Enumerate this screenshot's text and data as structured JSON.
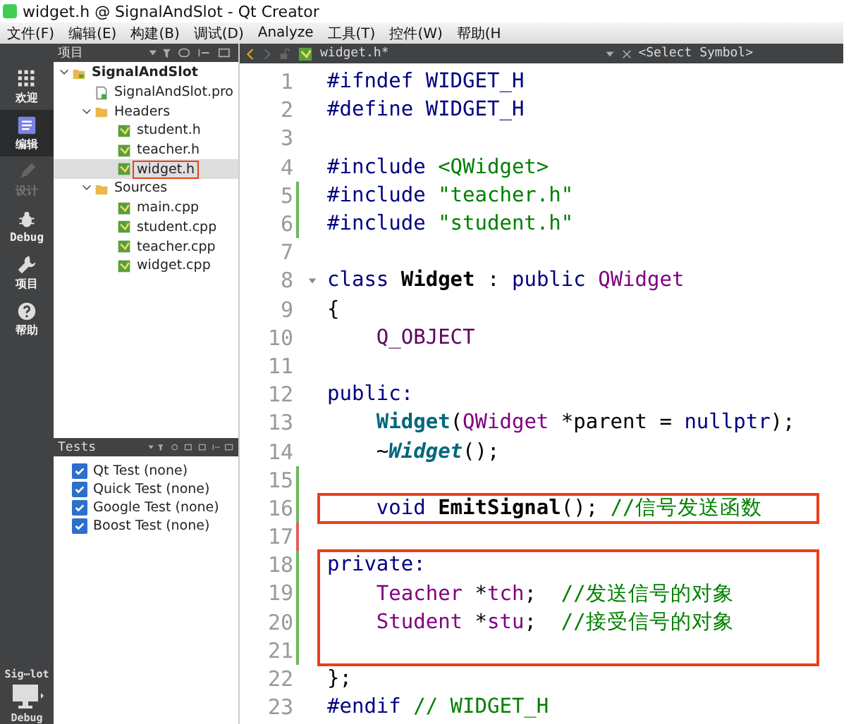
{
  "window": {
    "title": "widget.h @ SignalAndSlot - Qt Creator"
  },
  "menu": [
    "文件(F)",
    "编辑(E)",
    "构建(B)",
    "调试(D)",
    "Analyze",
    "工具(T)",
    "控件(W)",
    "帮助(H"
  ],
  "modes": [
    {
      "label": "欢迎",
      "selected": false,
      "disabled": false
    },
    {
      "label": "编辑",
      "selected": true,
      "disabled": false
    },
    {
      "label": "设计",
      "selected": false,
      "disabled": true
    },
    {
      "label": "Debug",
      "selected": false,
      "disabled": false
    },
    {
      "label": "项目",
      "selected": false,
      "disabled": false
    },
    {
      "label": "帮助",
      "selected": false,
      "disabled": false
    }
  ],
  "target": {
    "project": "Sig⋯lot",
    "label": "Debug"
  },
  "project_panel": {
    "title": "项目",
    "tree": [
      {
        "label": "SignalAndSlot",
        "kind": "project",
        "expanded": true,
        "selected": false,
        "children": [
          {
            "label": "SignalAndSlot.pro",
            "kind": "pro",
            "selected": false
          },
          {
            "label": "Headers",
            "kind": "folder",
            "expanded": true,
            "selected": false,
            "children": [
              {
                "label": "student.h",
                "kind": "file",
                "selected": false
              },
              {
                "label": "teacher.h",
                "kind": "file",
                "selected": false
              },
              {
                "label": "widget.h",
                "kind": "file",
                "selected": true
              }
            ]
          },
          {
            "label": "Sources",
            "kind": "folder",
            "expanded": true,
            "selected": false,
            "children": [
              {
                "label": "main.cpp",
                "kind": "file",
                "selected": false
              },
              {
                "label": "student.cpp",
                "kind": "file",
                "selected": false
              },
              {
                "label": "teacher.cpp",
                "kind": "file",
                "selected": false
              },
              {
                "label": "widget.cpp",
                "kind": "file",
                "selected": false
              }
            ]
          }
        ]
      }
    ]
  },
  "tests_panel": {
    "title": "Tests",
    "items": [
      {
        "label": "Qt Test (none)",
        "checked": true
      },
      {
        "label": "Quick Test (none)",
        "checked": true
      },
      {
        "label": "Google Test (none)",
        "checked": true
      },
      {
        "label": "Boost Test (none)",
        "checked": true
      }
    ]
  },
  "editor": {
    "file_tab": "widget.h*",
    "symbol": "<Select Symbol>",
    "lines": [
      {
        "number": "1",
        "tokens": [
          {
            "kind": "kw",
            "text": "#ifndef WIDGET_H"
          }
        ]
      },
      {
        "number": "2",
        "tokens": [
          {
            "kind": "kw",
            "text": "#define WIDGET_H"
          }
        ]
      },
      {
        "number": "3"
      },
      {
        "number": "4",
        "tokens": [
          {
            "kind": "kw",
            "text": "#include "
          },
          {
            "kind": "str",
            "text": "<QWidget>"
          }
        ]
      },
      {
        "number": "5",
        "changed": true,
        "saved": true,
        "tokens": [
          {
            "kind": "kw",
            "text": "#include "
          },
          {
            "kind": "str",
            "text": "\"teacher.h\""
          }
        ]
      },
      {
        "number": "6",
        "changed": true,
        "saved": true,
        "tokens": [
          {
            "kind": "kw",
            "text": "#include "
          },
          {
            "kind": "str",
            "text": "\"student.h\""
          }
        ]
      },
      {
        "number": "7"
      },
      {
        "number": "8",
        "fold": true,
        "tokens": [
          {
            "kind": "kw",
            "text": "class "
          },
          {
            "kind": "fn",
            "text": "Widget"
          },
          {
            "kind": "plain",
            "text": " : "
          },
          {
            "kind": "kw",
            "text": "public "
          },
          {
            "kind": "type",
            "text": "QWidget"
          }
        ]
      },
      {
        "number": "9",
        "tokens": [
          {
            "kind": "plain",
            "text": "{"
          }
        ]
      },
      {
        "number": "10",
        "tokens": [
          {
            "kind": "macro",
            "text": "    Q_OBJECT"
          }
        ]
      },
      {
        "number": "11"
      },
      {
        "number": "12",
        "tokens": [
          {
            "kind": "kw",
            "text": "public:"
          }
        ]
      },
      {
        "number": "13",
        "tokens": [
          {
            "kind": "fnc",
            "text": "    Widget"
          },
          {
            "kind": "plain",
            "text": "("
          },
          {
            "kind": "type",
            "text": "QWidget"
          },
          {
            "kind": "plain",
            "text": " *parent = "
          },
          {
            "kind": "kw",
            "text": "nullptr"
          },
          {
            "kind": "plain",
            "text": ");"
          }
        ]
      },
      {
        "number": "14",
        "tokens": [
          {
            "kind": "plain",
            "text": "    ~"
          },
          {
            "kind": "fni",
            "text": "Widget"
          },
          {
            "kind": "plain",
            "text": "();"
          }
        ]
      },
      {
        "number": "15",
        "changed": true,
        "saved": true
      },
      {
        "number": "16",
        "changed": true,
        "saved": true,
        "boxed": true,
        "tokens": [
          {
            "kind": "kw",
            "text": "    void "
          },
          {
            "kind": "fn",
            "text": "EmitSignal"
          },
          {
            "kind": "plain",
            "text": "(); "
          },
          {
            "kind": "com",
            "text": "//信号发送函数"
          }
        ]
      },
      {
        "number": "17",
        "changed": true,
        "saved": false
      },
      {
        "number": "18",
        "changed": true,
        "saved": true,
        "boxed": true,
        "tokens": [
          {
            "kind": "kw",
            "text": "private:"
          }
        ]
      },
      {
        "number": "19",
        "changed": true,
        "saved": true,
        "boxed": true,
        "tokens": [
          {
            "kind": "type",
            "text": "    Teacher"
          },
          {
            "kind": "plain",
            "text": " *"
          },
          {
            "kind": "field",
            "text": "tch"
          },
          {
            "kind": "plain",
            "text": ";  "
          },
          {
            "kind": "com",
            "text": "//发送信号的对象"
          }
        ]
      },
      {
        "number": "20",
        "changed": true,
        "saved": true,
        "boxed": true,
        "tokens": [
          {
            "kind": "type",
            "text": "    Student"
          },
          {
            "kind": "plain",
            "text": " *"
          },
          {
            "kind": "field",
            "text": "stu"
          },
          {
            "kind": "plain",
            "text": ";  "
          },
          {
            "kind": "com",
            "text": "//接受信号的对象"
          }
        ]
      },
      {
        "number": "21",
        "changed": true,
        "saved": true,
        "boxed": true
      },
      {
        "number": "22",
        "tokens": [
          {
            "kind": "plain",
            "text": "};"
          }
        ]
      },
      {
        "number": "23",
        "tokens": [
          {
            "kind": "kw",
            "text": "#endif "
          },
          {
            "kind": "com",
            "text": "// WIDGET_H"
          }
        ]
      }
    ]
  }
}
